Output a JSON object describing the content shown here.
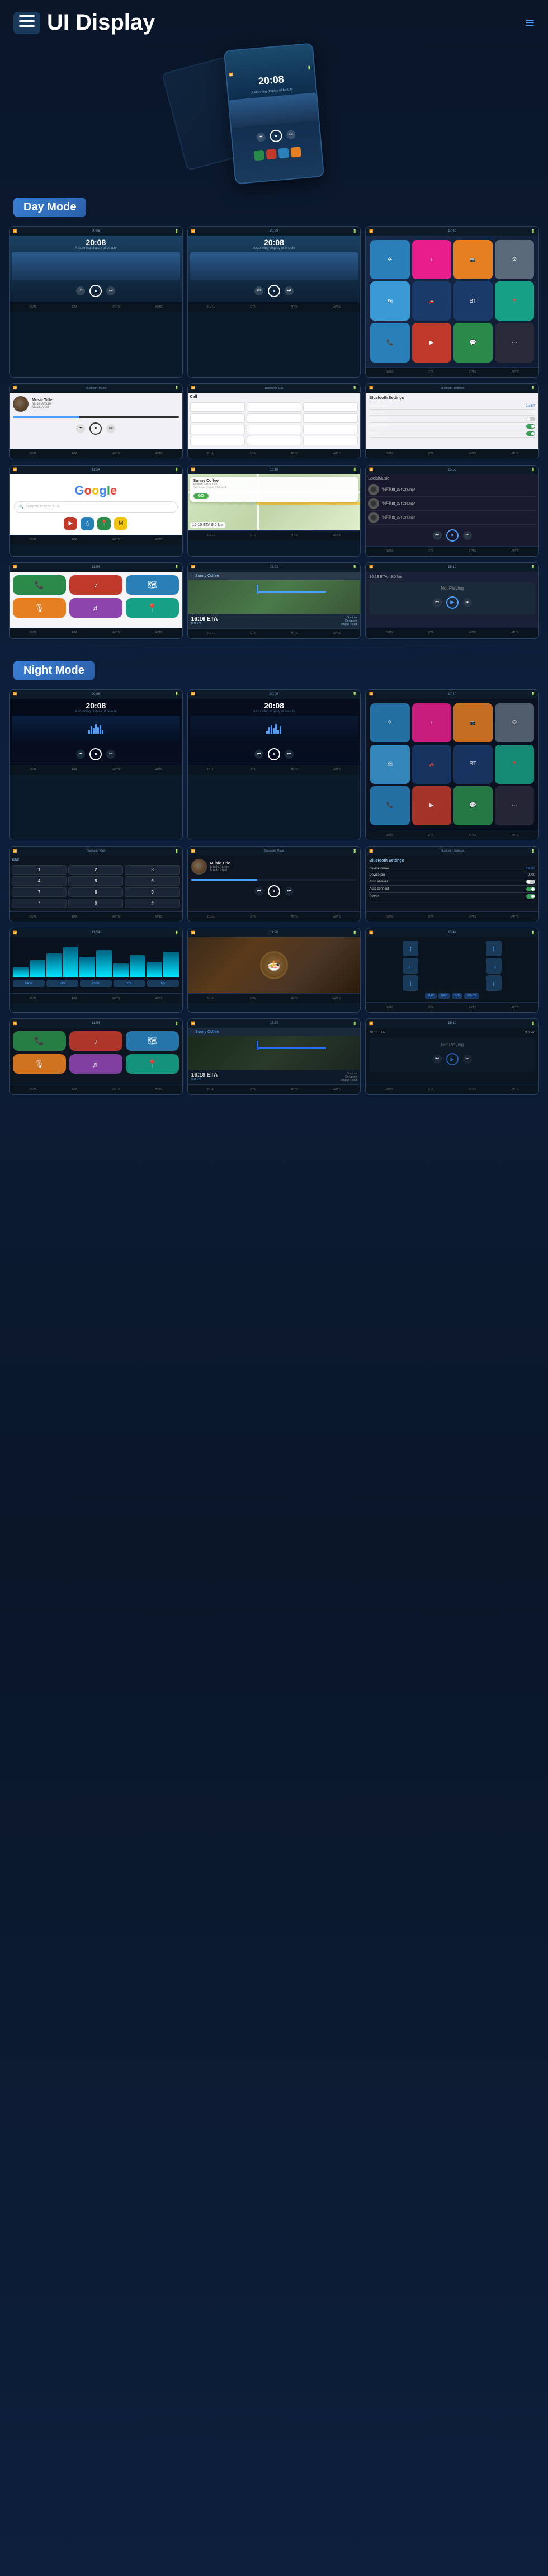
{
  "header": {
    "title": "UI Display",
    "menu_icon": "☰",
    "nav_icon": "≡"
  },
  "sections": {
    "day_mode": "Day Mode",
    "night_mode": "Night Mode"
  },
  "hero": {
    "time": "20:08",
    "subtitle": "A stunning display of beauty"
  },
  "screens": {
    "time1": "20:08",
    "time2": "20:08",
    "subtitle1": "A stunning display of beauty",
    "subtitle2": "A stunning display of beauty",
    "bluetooth_music": "Bluetooth_Music",
    "bluetooth_call": "Bluetooth_Call",
    "bluetooth_settings": "Bluetooth_Settings",
    "music_title": "Music Title",
    "music_album": "Music Album",
    "music_artist": "Music Artist",
    "device_name": "CarBT",
    "device_pin": "0000",
    "auto_answer": "Auto answer",
    "auto_connect": "Auto connect",
    "power": "Power",
    "google_text": "Google",
    "search_placeholder": "Search...",
    "sunny_coffee": "Sunny Coffee",
    "modern_restaurant": "Modern Restaurant",
    "restaurant_addr": "Sunflower Street, Oakland",
    "eta_label": "16:16 ETA",
    "eta_dist": "9.0 km",
    "go": "GO",
    "start_on": "Start on",
    "donglove": "Donglove",
    "tongue_road": "Tongue Road",
    "not_playing": "Not Playing"
  },
  "status_bar": {
    "items": [
      "DUAL",
      "ETA",
      "APTS",
      "APTS"
    ]
  },
  "keypad": {
    "keys": [
      "1",
      "2",
      "3",
      "4",
      "5",
      "6",
      "7",
      "8",
      "9",
      "*",
      "0",
      "#"
    ]
  },
  "night_screens": {
    "time1": "20:08",
    "time2": "20:08",
    "bluetooth_call": "Bluetooth_Call",
    "bluetooth_music": "Bluetooth_Music",
    "bluetooth_settings": "Bluetooth_Settings",
    "music_title": "Music Title",
    "music_album": "Music Album",
    "music_artist": "Music Artist"
  }
}
